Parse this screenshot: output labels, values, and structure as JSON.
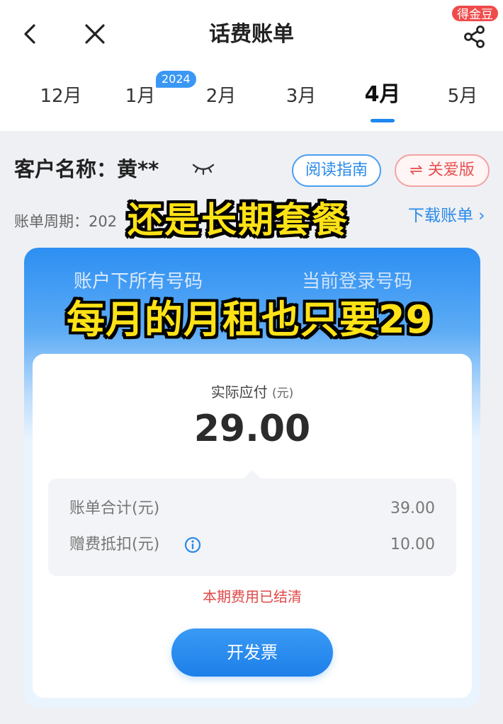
{
  "header": {
    "title": "话费账单",
    "coin_badge": "得金豆",
    "icons": {
      "back": "back-arrow-icon",
      "close": "close-icon",
      "share": "share-icon"
    }
  },
  "year_badge": "2024",
  "tabs": [
    {
      "label": "12月"
    },
    {
      "label": "1月"
    },
    {
      "label": "2月"
    },
    {
      "label": "3月"
    },
    {
      "label": "4月",
      "active": true
    },
    {
      "label": "5月"
    }
  ],
  "customer": {
    "label": "客户名称：黄**",
    "guide_button": "阅读指南",
    "care_button": "⇌ 关爱版"
  },
  "bill": {
    "period": "账单周期：202",
    "download_link": "下载账单 ›"
  },
  "card": {
    "tab_all": "账户下所有号码",
    "tab_current": "当前登录号码",
    "due_label": "实际应付",
    "due_unit": "(元)",
    "due_amount": "29.00",
    "details": [
      {
        "label": "账单合计(元)",
        "value": "39.00"
      },
      {
        "label": "赠费抵扣(元)",
        "value": "10.00"
      }
    ],
    "settled": "本期费用已结清",
    "invoice_button": "开发票"
  },
  "overlay": {
    "caption1": "还是长期套餐",
    "caption2": "每月的月租也只要29"
  },
  "colors": {
    "accent": "#1e86f0",
    "danger": "#e04848",
    "caption": "#ffe216"
  }
}
